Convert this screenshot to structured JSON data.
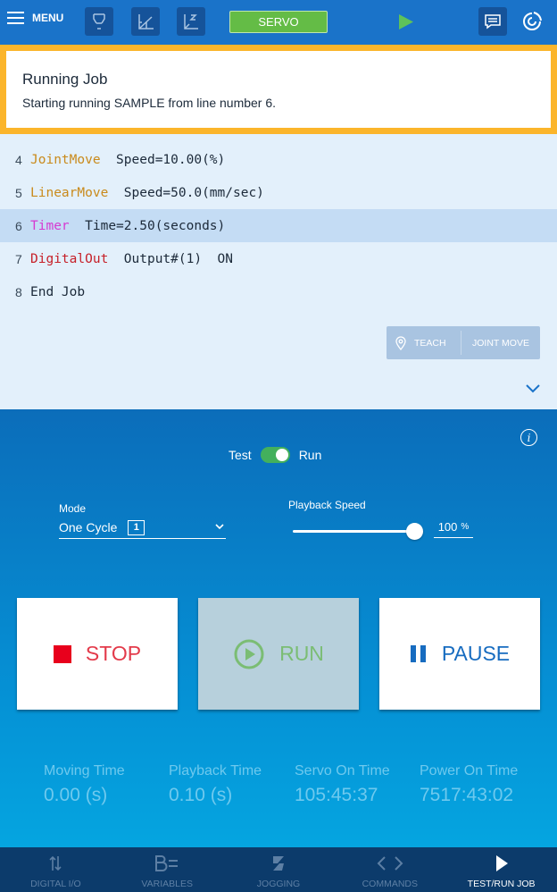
{
  "topbar": {
    "menu_label": "MENU",
    "servo_label": "SERVO",
    "icons": [
      "hamburger-icon",
      "tool-frame-icon",
      "user-frame-icon",
      "joint-frame-icon",
      "play-icon",
      "message-icon",
      "logo-icon"
    ],
    "colors": {
      "bar": "#1a73c9",
      "servo": "#64bc46",
      "play": "#5ec25a"
    }
  },
  "notification": {
    "title": "Running Job",
    "message": "Starting running SAMPLE from line number 6.",
    "border_color": "#fbb52b"
  },
  "code": {
    "lines": [
      {
        "num": "4",
        "keyword": "JointMove",
        "args": "Speed=10.00(%)",
        "color": "orange",
        "active": false
      },
      {
        "num": "5",
        "keyword": "LinearMove",
        "args": "Speed=50.0(mm/sec)",
        "color": "orange",
        "active": false
      },
      {
        "num": "6",
        "keyword": "Timer",
        "args": "Time=2.50(seconds)",
        "color": "magenta",
        "active": true
      },
      {
        "num": "7",
        "keyword": "DigitalOut",
        "args": "Output#(1)  ON",
        "color": "red",
        "active": false
      },
      {
        "num": "8",
        "keyword": "",
        "args": "End Job",
        "color": "",
        "active": false
      }
    ],
    "teach_label": "TEACH",
    "joint_move_label": "JOINT MOVE"
  },
  "control": {
    "toggle_left": "Test",
    "toggle_right": "Run",
    "mode_label": "Mode",
    "mode_value": "One Cycle",
    "cycle_icon_text": "1",
    "speed_label": "Playback Speed",
    "speed_value": "100",
    "speed_unit": "%",
    "speed_fraction": 1.0,
    "stop_label": "STOP",
    "run_label": "RUN",
    "pause_label": "PAUSE"
  },
  "stats": [
    {
      "label": "Moving Time",
      "value": "0.00 (s)"
    },
    {
      "label": "Playback Time",
      "value": "0.10 (s)"
    },
    {
      "label": "Servo On Time",
      "value": "105:45:37"
    },
    {
      "label": "Power On Time",
      "value": "7517:43:02"
    }
  ],
  "bottomnav": {
    "items": [
      {
        "label": "DIGITAL I/O",
        "icon": "digital-io-icon",
        "active": false
      },
      {
        "label": "VARIABLES",
        "icon": "variables-icon",
        "active": false
      },
      {
        "label": "JOGGING",
        "icon": "jogging-icon",
        "active": false
      },
      {
        "label": "COMMANDS",
        "icon": "commands-icon",
        "active": false
      },
      {
        "label": "TEST/RUN JOB",
        "icon": "test-run-icon",
        "active": true
      }
    ]
  }
}
